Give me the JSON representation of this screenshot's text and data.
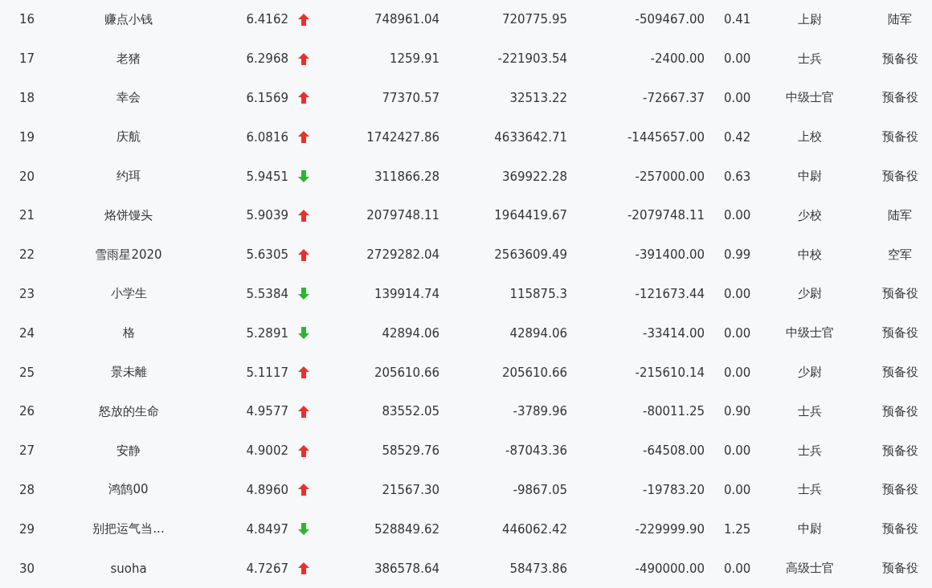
{
  "table": {
    "rows": [
      {
        "column_1": "16",
        "column_2": "赚点小钱",
        "column_3": "6.4162",
        "rising": true,
        "column_4": "748961.04",
        "column_5": "720775.95",
        "column_6": "-509467.00",
        "column_7": "0.41",
        "column_8": "上尉",
        "column_9": "陆军"
      },
      {
        "column_1": "17",
        "column_2": "老猪",
        "column_3": "6.2968",
        "rising": true,
        "column_4": "1259.91",
        "column_5": "-221903.54",
        "column_6": "-2400.00",
        "column_7": "0.00",
        "column_8": "士兵",
        "column_9": "预备役"
      },
      {
        "column_1": "18",
        "column_2": "幸会",
        "column_3": "6.1569",
        "rising": true,
        "column_4": "77370.57",
        "column_5": "32513.22",
        "column_6": "-72667.37",
        "column_7": "0.00",
        "column_8": "中级士官",
        "column_9": "预备役"
      },
      {
        "column_1": "19",
        "column_2": "庆航",
        "column_3": "6.0816",
        "rising": true,
        "column_4": "1742427.86",
        "column_5": "4633642.71",
        "column_6": "-1445657.00",
        "column_7": "0.42",
        "column_8": "上校",
        "column_9": "预备役"
      },
      {
        "column_1": "20",
        "column_2": "约珥",
        "column_3": "5.9451",
        "rising": false,
        "column_4": "311866.28",
        "column_5": "369922.28",
        "column_6": "-257000.00",
        "column_7": "0.63",
        "column_8": "中尉",
        "column_9": "预备役"
      },
      {
        "column_1": "21",
        "column_2": "烙饼馒头",
        "column_3": "5.9039",
        "rising": true,
        "column_4": "2079748.11",
        "column_5": "1964419.67",
        "column_6": "-2079748.11",
        "column_7": "0.00",
        "column_8": "少校",
        "column_9": "陆军"
      },
      {
        "column_1": "22",
        "column_2": "雪雨星2020",
        "column_3": "5.6305",
        "rising": true,
        "column_4": "2729282.04",
        "column_5": "2563609.49",
        "column_6": "-391400.00",
        "column_7": "0.99",
        "column_8": "中校",
        "column_9": "空军"
      },
      {
        "column_1": "23",
        "column_2": "小学生",
        "column_3": "5.5384",
        "rising": false,
        "column_4": "139914.74",
        "column_5": "115875.3",
        "column_6": "-121673.44",
        "column_7": "0.00",
        "column_8": "少尉",
        "column_9": "预备役"
      },
      {
        "column_1": "24",
        "column_2": "格",
        "column_3": "5.2891",
        "rising": false,
        "column_4": "42894.06",
        "column_5": "42894.06",
        "column_6": "-33414.00",
        "column_7": "0.00",
        "column_8": "中级士官",
        "column_9": "预备役"
      },
      {
        "column_1": "25",
        "column_2": "景未離",
        "column_3": "5.1117",
        "rising": true,
        "column_4": "205610.66",
        "column_5": "205610.66",
        "column_6": "-215610.14",
        "column_7": "0.00",
        "column_8": "少尉",
        "column_9": "预备役"
      },
      {
        "column_1": "26",
        "column_2": "怒放的生命",
        "column_3": "4.9577",
        "rising": true,
        "column_4": "83552.05",
        "column_5": "-3789.96",
        "column_6": "-80011.25",
        "column_7": "0.90",
        "column_8": "士兵",
        "column_9": "预备役"
      },
      {
        "column_1": "27",
        "column_2": "安静",
        "column_3": "4.9002",
        "rising": true,
        "column_4": "58529.76",
        "column_5": "-87043.36",
        "column_6": "-64508.00",
        "column_7": "0.00",
        "column_8": "士兵",
        "column_9": "预备役"
      },
      {
        "column_1": "28",
        "column_2": "鸿鹄00",
        "column_3": "4.8960",
        "rising": true,
        "column_4": "21567.30",
        "column_5": "-9867.05",
        "column_6": "-19783.20",
        "column_7": "0.00",
        "column_8": "士兵",
        "column_9": "预备役"
      },
      {
        "column_1": "29",
        "column_2": "别把运气当...",
        "column_3": "4.8497",
        "rising": false,
        "column_4": "528849.62",
        "column_5": "446062.42",
        "column_6": "-229999.90",
        "column_7": "1.25",
        "column_8": "中尉",
        "column_9": "预备役"
      },
      {
        "column_1": "30",
        "column_2": "suoha",
        "column_3": "4.7267",
        "rising": true,
        "column_4": "386578.64",
        "column_5": "58473.86",
        "column_6": "-490000.00",
        "column_7": "0.00",
        "column_8": "高级士官",
        "column_9": "预备役"
      }
    ]
  }
}
